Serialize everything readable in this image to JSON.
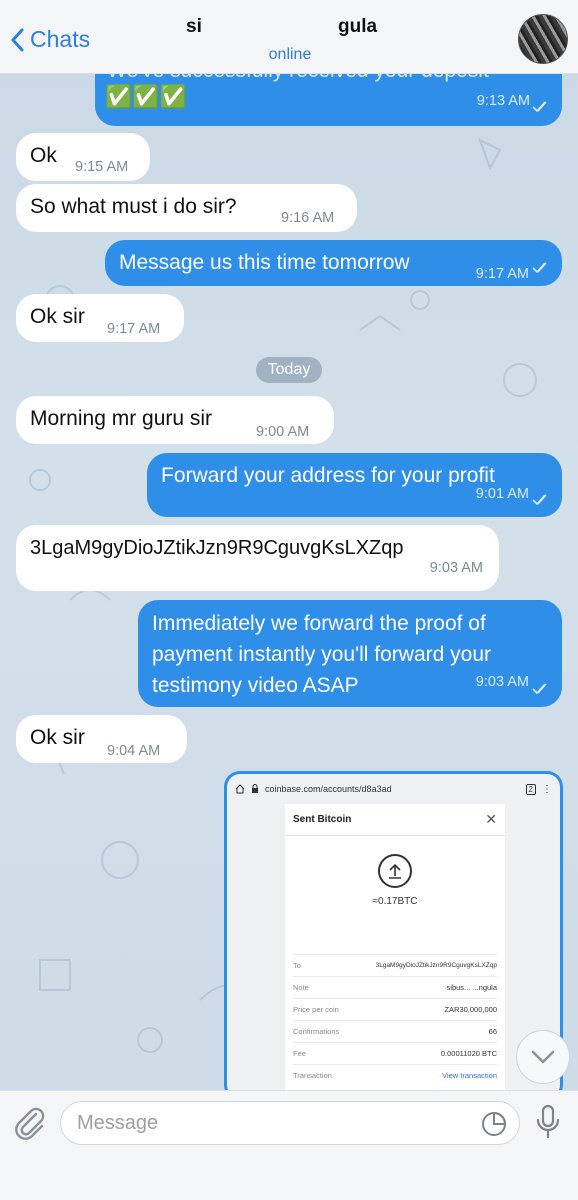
{
  "header": {
    "back_label": "Chats",
    "contact_name_left": "si",
    "contact_name_right": "gula",
    "status": "online"
  },
  "messages": [
    {
      "text": "We've successfully received your deposit",
      "extra": "✅✅✅",
      "time": "9:13 AM"
    },
    {
      "text": "Ok",
      "time": "9:15 AM"
    },
    {
      "text": "So what must i do sir?",
      "time": "9:16 AM"
    },
    {
      "text": "Message us this time tomorrow",
      "time": "9:17 AM"
    },
    {
      "text": "Ok sir",
      "time": "9:17 AM"
    },
    {
      "text": "Morning mr guru sir",
      "time": "9:00 AM"
    },
    {
      "text": "Forward your address for your profit",
      "time": "9:01 AM"
    },
    {
      "text": "3LgaM9gyDioJZtikJzn9R9CguvgKsLXZqp",
      "time": "9:03 AM"
    },
    {
      "text_lines": [
        "Immediately we forward the proof of",
        "payment instantly you'll forward your",
        "testimony video ASAP"
      ],
      "time": "9:03 AM"
    },
    {
      "text": "Ok sir",
      "time": "9:04 AM"
    }
  ],
  "date_separator": "Today",
  "screenshot": {
    "url": "coinbase.com/accounts/d8a3ad",
    "tab_count": "2",
    "title": "Sent Bitcoin",
    "amount": "≈0.17BTC",
    "rows": [
      {
        "label": "To",
        "value": "3LgaM9gyDioJZtikJzn9R9CguvgKsLXZqp"
      },
      {
        "label": "Note",
        "value": "sibus...  ...ngula"
      },
      {
        "label": "Price per coin",
        "value": "ZAR30,000,000"
      },
      {
        "label": "Confirmations",
        "value": "66"
      },
      {
        "label": "Fee",
        "value": "0.00011020 BTC"
      },
      {
        "label": "Transaction",
        "value": "View transaction"
      }
    ]
  },
  "input": {
    "placeholder": "Message"
  },
  "colors": {
    "accent": "#2f8ee8",
    "link": "#2c7ee0"
  }
}
